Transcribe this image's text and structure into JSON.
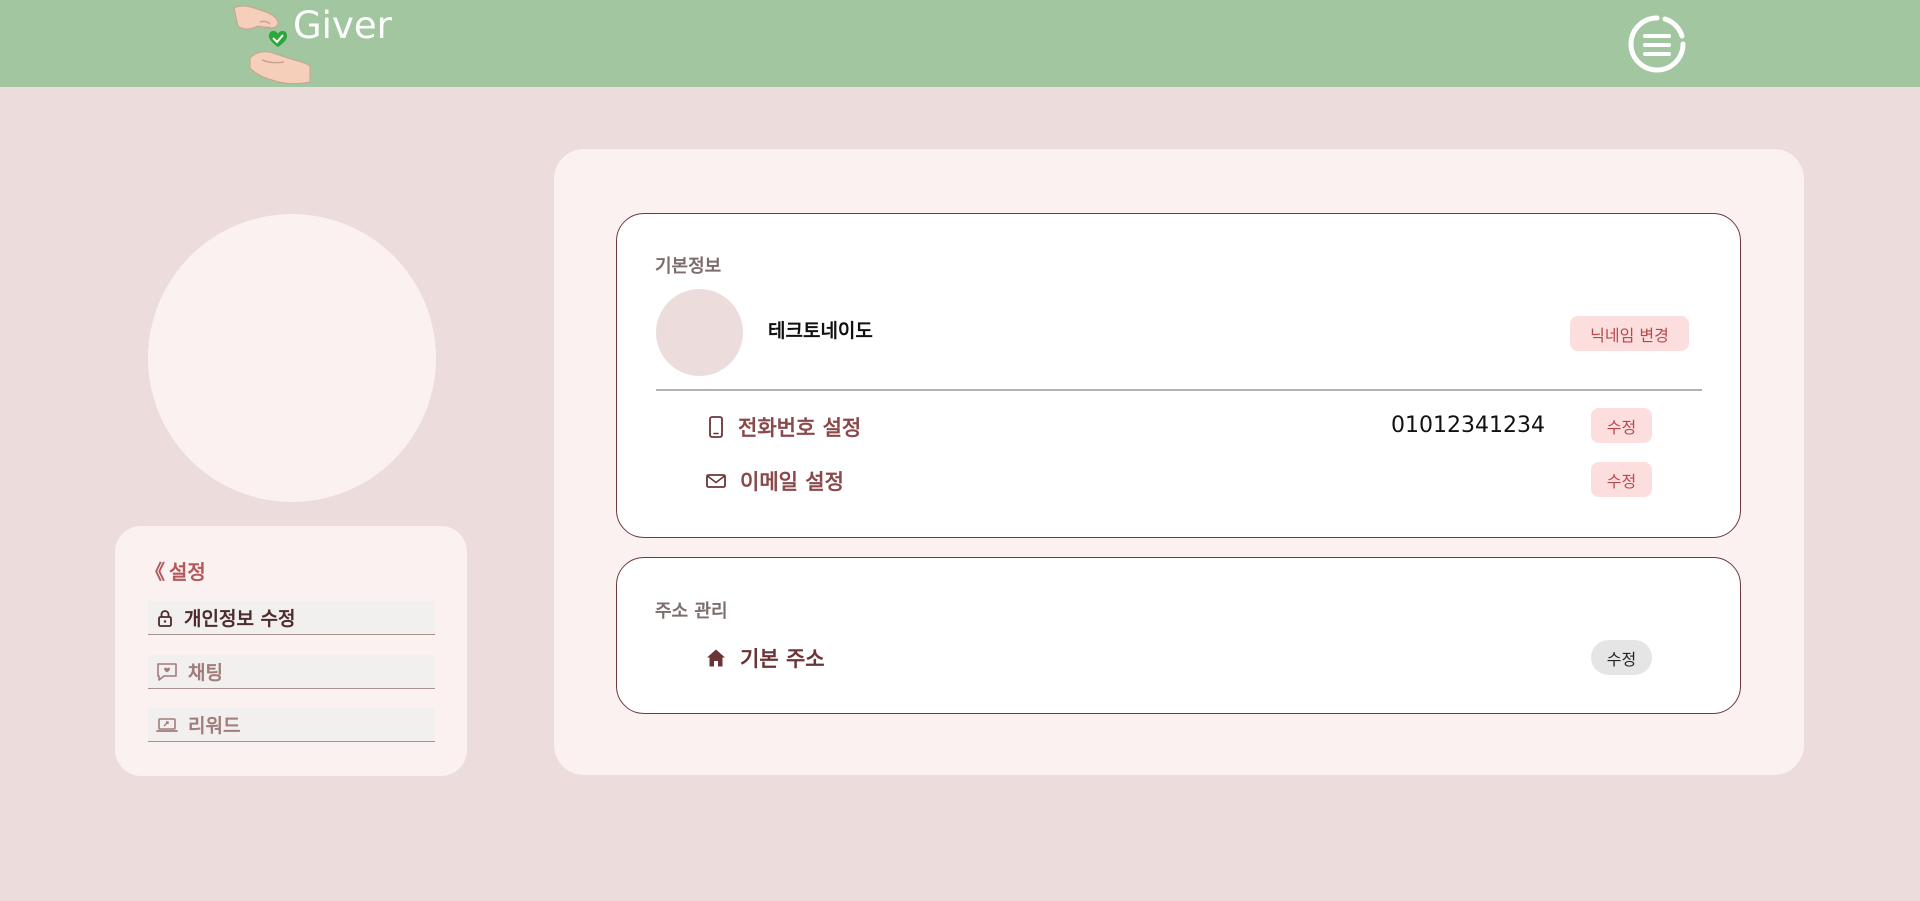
{
  "header": {
    "brand": "Giver",
    "colors": {
      "bar": "#a2c6a0",
      "brand_text": "#ffffff"
    }
  },
  "sidebar": {
    "title": "설정",
    "title_prefix": "《",
    "items": [
      {
        "label": "개인정보 수정",
        "icon": "lock-icon",
        "active": true
      },
      {
        "label": "채팅",
        "icon": "chat-bubble-heart-icon",
        "active": false
      },
      {
        "label": "리워드",
        "icon": "laptop-reward-icon",
        "active": false
      }
    ]
  },
  "basic_info": {
    "section_title": "기본정보",
    "nickname": "테크토네이도",
    "nickname_button": "닉네임 변경",
    "phone": {
      "label": "전화번호 설정",
      "icon": "phone-icon",
      "value": "01012341234",
      "button": "수정"
    },
    "email": {
      "label": "이메일 설정",
      "icon": "mail-icon",
      "value": "",
      "button": "수정"
    }
  },
  "address": {
    "section_title": "주소 관리",
    "default_label": "기본 주소",
    "icon": "home-icon",
    "button": "수정"
  },
  "colors": {
    "page_bg": "#ecdcdc",
    "card_bg": "#faf1f0",
    "accent": "#b8484b",
    "pill_bg": "#fbdedd",
    "border": "#6a3a3d"
  }
}
